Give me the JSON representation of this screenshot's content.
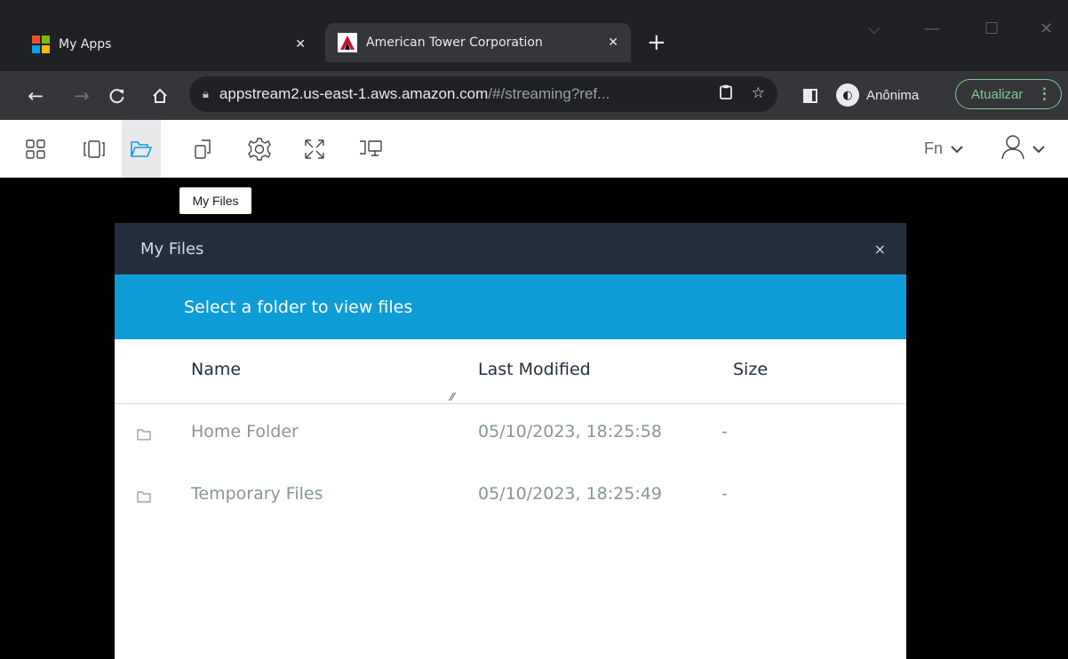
{
  "browser": {
    "tabs": [
      {
        "title": "My Apps",
        "active": false
      },
      {
        "title": "American Tower Corporation",
        "active": true
      }
    ],
    "new_tab_symbol": "+",
    "close_symbol": "✕",
    "url_host": "appstream2.us-east-1.aws.amazon.com",
    "url_rest": "/#/streaming?ref...",
    "incognito_label": "Anônima",
    "update_label": "Atualizar",
    "colors": {
      "tab_bg": "#202124",
      "active_tab": "#35363a",
      "update_green": "#81c995"
    }
  },
  "toolbar": {
    "icons": [
      "catalog-icon",
      "windows-icon",
      "my-files-icon",
      "clipboard-icon",
      "settings-icon",
      "fullscreen-icon",
      "display-icon"
    ],
    "active_icon": "my-files-icon",
    "fn_label": "Fn",
    "active_color": "#0e9cd7"
  },
  "tooltip": {
    "text": "My Files"
  },
  "dialog": {
    "title": "My Files",
    "close_symbol": "×",
    "banner_text": "Select a folder to view files",
    "columns": {
      "name": "Name",
      "modified": "Last Modified",
      "size": "Size"
    },
    "rows": [
      {
        "name": "Home Folder",
        "modified": "05/10/2023, 18:25:58",
        "size": "-"
      },
      {
        "name": "Temporary Files",
        "modified": "05/10/2023, 18:25:49",
        "size": "-"
      }
    ],
    "colors": {
      "header_bg": "#232f3e",
      "banner_bg": "#0e9cd7"
    }
  }
}
